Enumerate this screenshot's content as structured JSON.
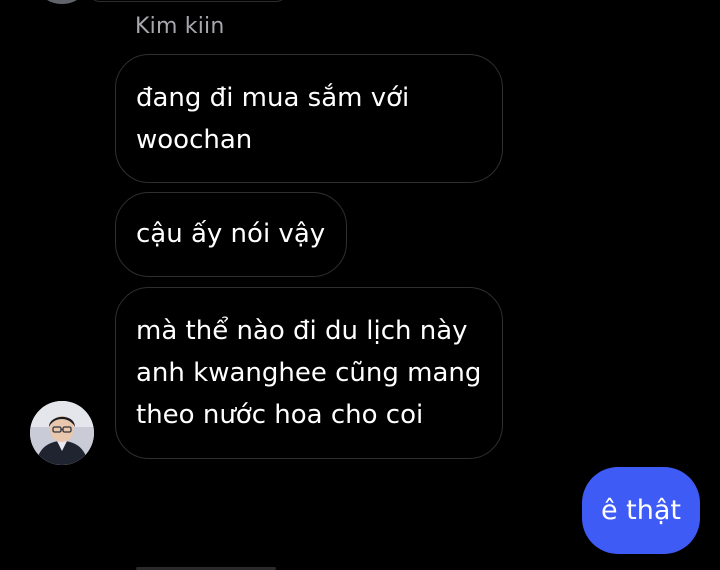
{
  "thread": {
    "sender_name": "Kim kiin",
    "incoming": [
      {
        "lines": [
          "đang đi mua sắm với",
          "woochan"
        ]
      },
      {
        "lines": [
          "cậu ấy nói vậy"
        ]
      },
      {
        "lines": [
          "mà thể nào đi du lịch này",
          "anh kwanghee cũng mang",
          "theo nước hoa  cho coi"
        ]
      }
    ],
    "outgoing": [
      {
        "text": "ê thật"
      }
    ]
  },
  "colors": {
    "background": "#000000",
    "incoming_border": "#2f2f31",
    "outgoing_bubble": "#3f5bf5",
    "sender_name": "#a7a7ad"
  }
}
